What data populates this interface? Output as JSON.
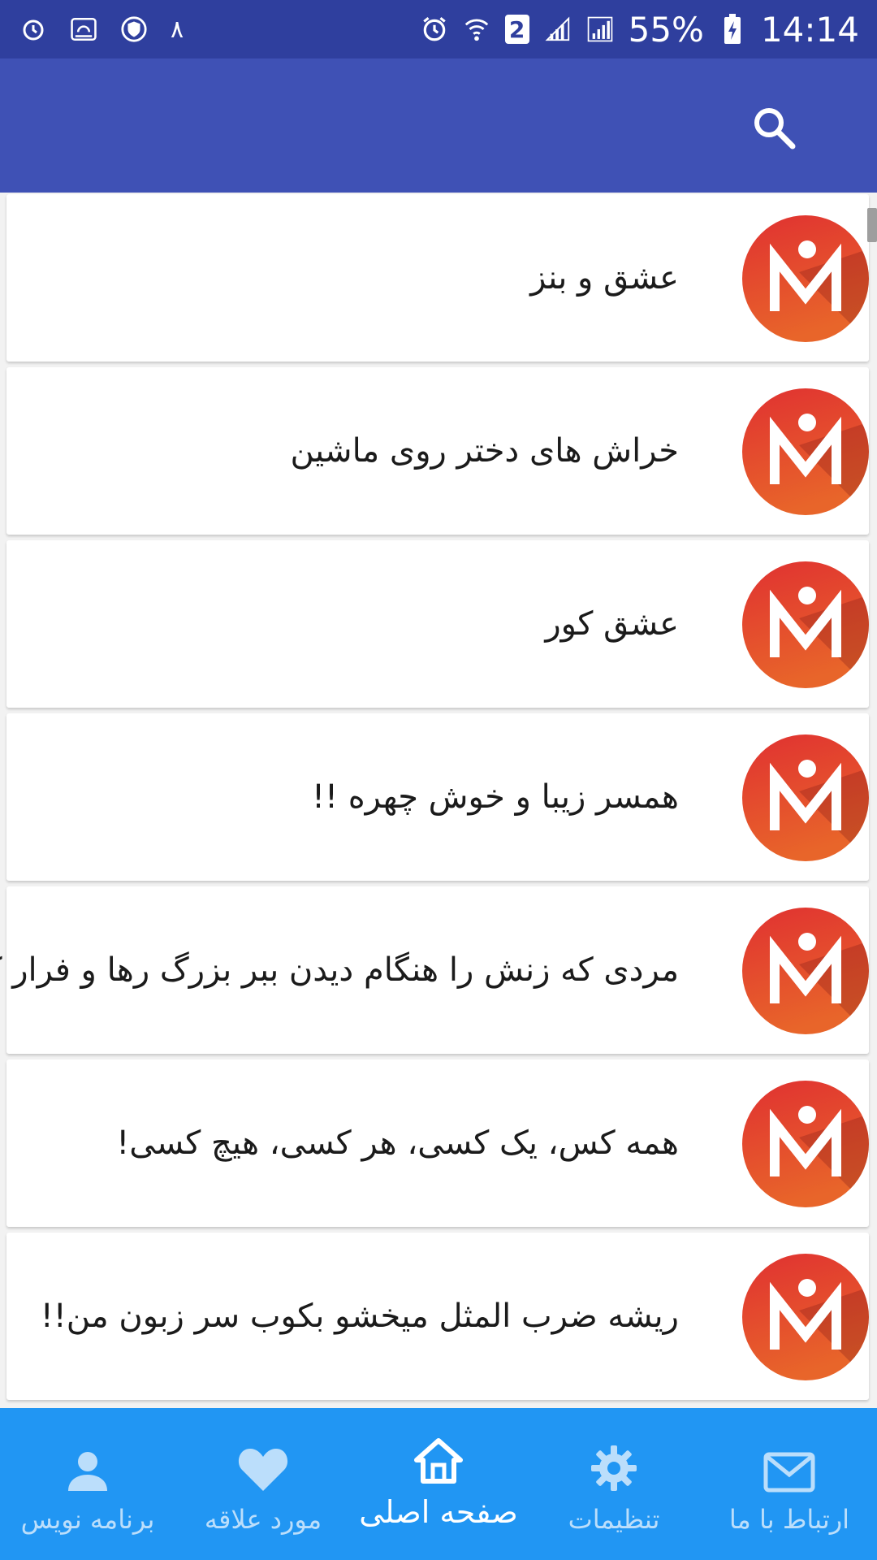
{
  "status_bar": {
    "notification_count": "٨",
    "sim_badge": "2",
    "battery_percent": "55%",
    "time": "14:14"
  },
  "app_bar": {
    "search_icon": "search-icon"
  },
  "items": [
    {
      "title": "عشق و بنز"
    },
    {
      "title": "خراش های دختر روی ماشین"
    },
    {
      "title": "عشق کور"
    },
    {
      "title": "همسر زیبا و خوش چهره !!"
    },
    {
      "title": "مردی که زنش را هنگام دیدن ببر بزرگ رها و فرار کرد!!"
    },
    {
      "title": "همه کس، یک کسی، هر کسی، هیچ کسی!"
    },
    {
      "title": "ریشه ضرب المثل میخشو بکوب سر زبون من!!"
    }
  ],
  "bottom_nav": {
    "contact": "ارتباط با ما",
    "settings": "تنظیمات",
    "home": "صفحه اصلی",
    "favorites": "مورد علاقه",
    "developer": "برنامه نویس"
  },
  "colors": {
    "status_bar": "#2f3f9e",
    "app_bar": "#3f51b5",
    "bottom_nav": "#2196f3",
    "avatar_red": "#e03131",
    "avatar_orange": "#e8652a"
  }
}
